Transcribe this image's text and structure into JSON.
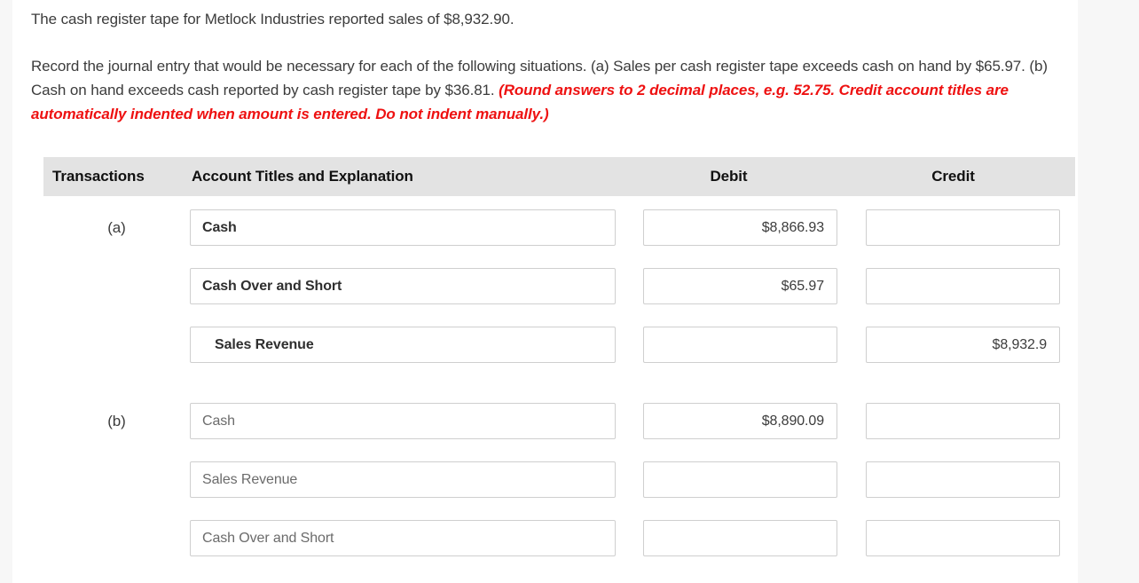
{
  "prompt": {
    "line1": "The cash register tape for Metlock Industries reported sales of $8,932.90.",
    "line2_part1": "Record the journal entry that would be necessary for each of the following situations. (a) Sales per cash register tape exceeds cash on hand by $65.97. (b) Cash on hand exceeds cash reported by cash register tape by $36.81. ",
    "line2_emphasis": "(Round answers to 2 decimal places, e.g. 52.75. Credit account titles are automatically indented when amount is entered. Do not indent manually.)"
  },
  "table": {
    "headers": {
      "transactions": "Transactions",
      "account": "Account Titles and Explanation",
      "debit": "Debit",
      "credit": "Credit"
    },
    "groups": [
      {
        "label": "(a)",
        "rows": [
          {
            "account": "Cash",
            "debit": "$8,866.93",
            "credit": "",
            "indented": false,
            "style": "strong"
          },
          {
            "account": "Cash Over and Short",
            "debit": "$65.97",
            "credit": "",
            "indented": false,
            "style": "strong"
          },
          {
            "account": "Sales Revenue",
            "debit": "",
            "credit": "$8,932.9",
            "indented": true,
            "style": "strong"
          }
        ]
      },
      {
        "label": "(b)",
        "rows": [
          {
            "account": "Cash",
            "debit": "$8,890.09",
            "credit": "",
            "indented": false,
            "style": "light"
          },
          {
            "account": "Sales Revenue",
            "debit": "",
            "credit": "",
            "indented": false,
            "style": "light"
          },
          {
            "account": "Cash Over and Short",
            "debit": "",
            "credit": "",
            "indented": false,
            "style": "light"
          }
        ]
      }
    ]
  },
  "colors": {
    "header_bg": "#e3e3e3",
    "emphasis_red": "#ee1111",
    "body_text": "#3c3c3c",
    "field_border": "#cfcfcf"
  }
}
